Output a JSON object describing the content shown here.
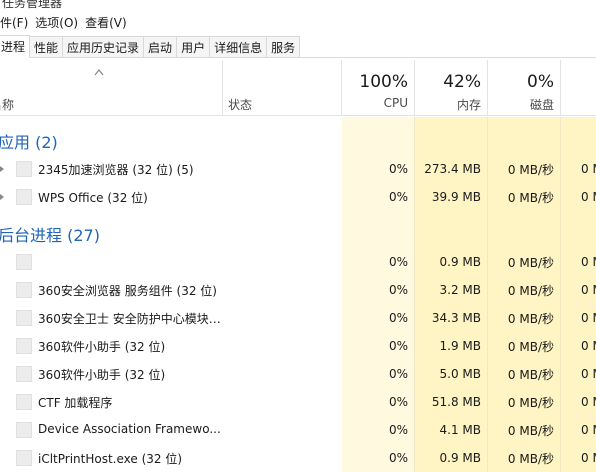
{
  "window": {
    "title": "任务管理器"
  },
  "menu": [
    "文件(F)",
    "选项(O)",
    "查看(V)"
  ],
  "tabs": [
    "进程",
    "性能",
    "应用历史记录",
    "启动",
    "用户",
    "详细信息",
    "服务"
  ],
  "header": {
    "name_label": "名称",
    "status_label": "状态",
    "cpu": {
      "pct": "100%",
      "label": "CPU"
    },
    "memory": {
      "pct": "42%",
      "label": "内存"
    },
    "disk": {
      "pct": "0%",
      "label": "磁盘"
    }
  },
  "groups": {
    "apps": {
      "title": "应用 (2)"
    },
    "background": {
      "title": "后台进程 (27)"
    }
  },
  "apps": [
    {
      "name": "2345加速浏览器 (32 位) (5)",
      "cpu": "0%",
      "memory": "273.4 MB",
      "disk": "0 MB/秒",
      "network": "0 M"
    },
    {
      "name": "WPS Office (32 位)",
      "cpu": "0%",
      "memory": "39.9 MB",
      "disk": "0 MB/秒",
      "network": "0 M"
    }
  ],
  "background": [
    {
      "name": "",
      "cpu": "0%",
      "memory": "0.9 MB",
      "disk": "0 MB/秒",
      "network": "0 M"
    },
    {
      "name": "360安全浏览器 服务组件 (32 位)",
      "cpu": "0%",
      "memory": "3.2 MB",
      "disk": "0 MB/秒",
      "network": "0 M"
    },
    {
      "name": "360安全卫士 安全防护中心模块…",
      "cpu": "0%",
      "memory": "34.3 MB",
      "disk": "0 MB/秒",
      "network": "0 M"
    },
    {
      "name": "360软件小助手 (32 位)",
      "cpu": "0%",
      "memory": "1.9 MB",
      "disk": "0 MB/秒",
      "network": "0 M"
    },
    {
      "name": "360软件小助手 (32 位)",
      "cpu": "0%",
      "memory": "5.0 MB",
      "disk": "0 MB/秒",
      "network": "0 M"
    },
    {
      "name": "CTF 加载程序",
      "cpu": "0%",
      "memory": "51.8 MB",
      "disk": "0 MB/秒",
      "network": "0 M"
    },
    {
      "name": "Device Association Framewo...",
      "cpu": "0%",
      "memory": "4.1 MB",
      "disk": "0 MB/秒",
      "network": "0 M"
    },
    {
      "name": "iCltPrintHost.exe (32 位)",
      "cpu": "0%",
      "memory": "0.9 MB",
      "disk": "0 MB/秒",
      "network": "0 M"
    }
  ],
  "colors": {
    "cpu_bg": "#fff9e0",
    "mem_bg_low": "#fff4c4",
    "mem_bg_high": "#ffe9a0",
    "disk_bg": "#fff4c4",
    "group_title": "#1f64b8"
  }
}
